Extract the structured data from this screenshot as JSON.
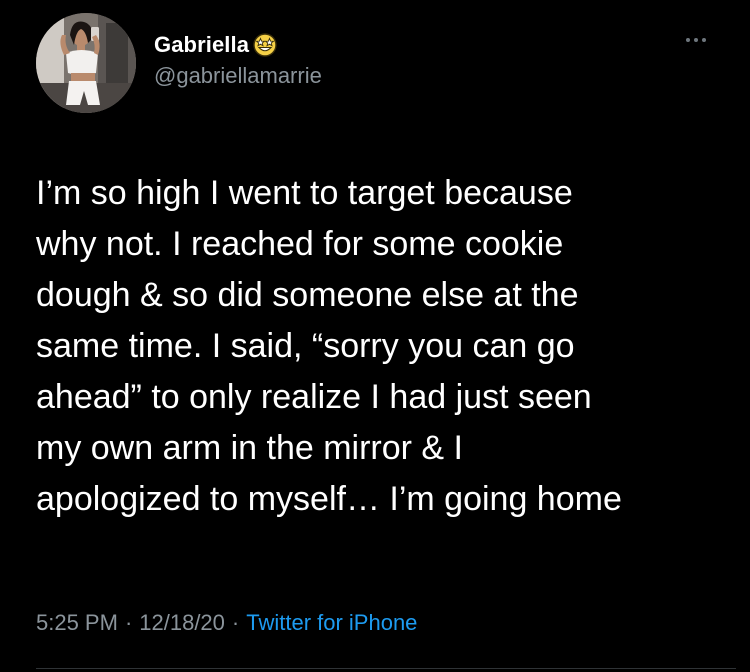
{
  "author": {
    "display_name": "Gabriella",
    "handle": "@gabriellamarrie",
    "emoji_icon": "star-struck-emoji-icon",
    "avatar": "profile-photo-avatar"
  },
  "more_icon": "more-options-icon",
  "tweet": {
    "lines": [
      "I’m so high I went to target because",
      "why not. I reached for some cookie",
      "dough & so did someone else at the",
      "same time. I said, “sorry you can go",
      "ahead” to only realize I had just seen",
      "my own arm in the mirror & I",
      "apologized to myself… I’m going home"
    ]
  },
  "meta": {
    "time": "5:25 PM",
    "date": "12/18/20",
    "separator": "·",
    "source": "Twitter for iPhone"
  },
  "colors": {
    "background": "#000000",
    "text": "#ffffff",
    "secondary_text": "#8b949b",
    "link": "#1d9bf0"
  }
}
